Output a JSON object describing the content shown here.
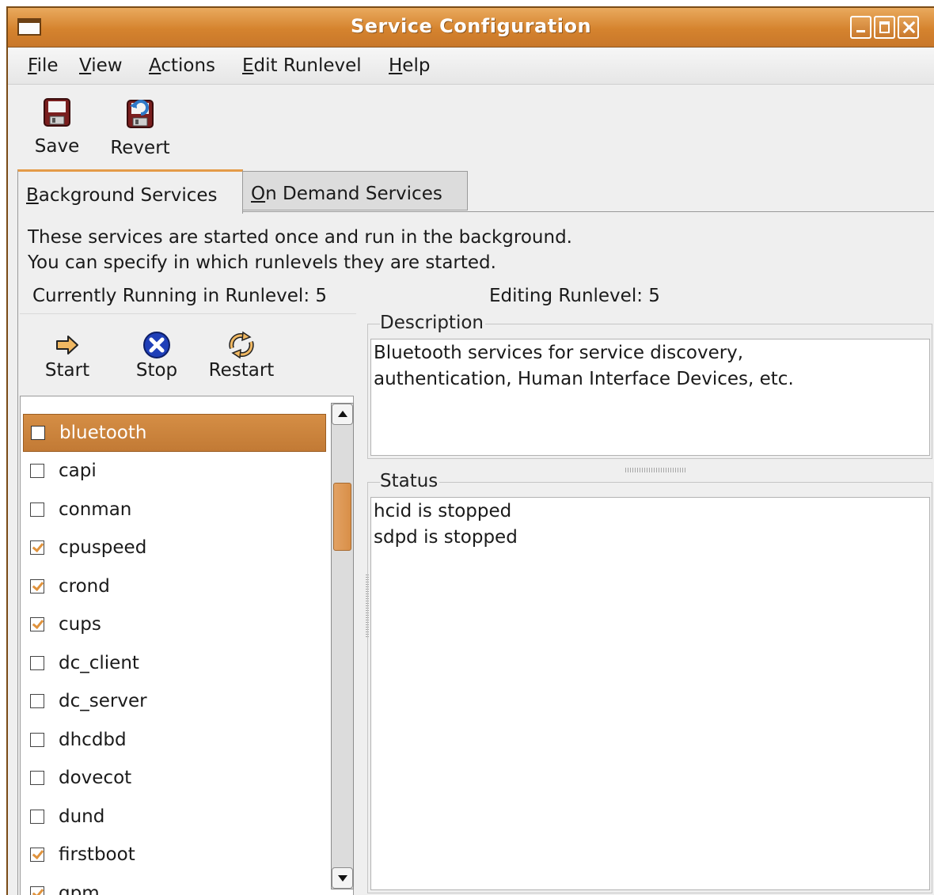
{
  "window": {
    "title": "Service Configuration"
  },
  "menubar": {
    "items": [
      {
        "mnemonic": "F",
        "rest": "ile"
      },
      {
        "mnemonic": "V",
        "rest": "iew"
      },
      {
        "mnemonic": "A",
        "rest": "ctions"
      },
      {
        "mnemonic": "E",
        "rest": "dit Runlevel"
      },
      {
        "mnemonic": "H",
        "rest": "elp"
      }
    ]
  },
  "toolbar": {
    "save_label": "Save",
    "revert_label": "Revert"
  },
  "tabs": [
    {
      "mnemonic": "B",
      "rest": "ackground Services",
      "active": true
    },
    {
      "mnemonic": "O",
      "rest": "n Demand Services",
      "active": false
    }
  ],
  "panel": {
    "intro_line1": "These services are started once and run in the background.",
    "intro_line2": "You can specify in which runlevels they are started.",
    "running_runlevel": "Currently Running in Runlevel: 5",
    "editing_runlevel": "Editing Runlevel: 5"
  },
  "actions": {
    "start_label": "Start",
    "stop_label": "Stop",
    "restart_label": "Restart"
  },
  "services": [
    {
      "name": "bluetooth",
      "enabled": false,
      "selected": true
    },
    {
      "name": "capi",
      "enabled": false
    },
    {
      "name": "conman",
      "enabled": false
    },
    {
      "name": "cpuspeed",
      "enabled": true
    },
    {
      "name": "crond",
      "enabled": true
    },
    {
      "name": "cups",
      "enabled": true
    },
    {
      "name": "dc_client",
      "enabled": false
    },
    {
      "name": "dc_server",
      "enabled": false
    },
    {
      "name": "dhcdbd",
      "enabled": false
    },
    {
      "name": "dovecot",
      "enabled": false
    },
    {
      "name": "dund",
      "enabled": false
    },
    {
      "name": "firstboot",
      "enabled": true
    },
    {
      "name": "gpm",
      "enabled": true
    }
  ],
  "description": {
    "label": "Description",
    "line1": "Bluetooth services for service discovery,",
    "line2": "authentication, Human Interface Devices, etc."
  },
  "status": {
    "label": "Status",
    "line1": "hcid is stopped",
    "line2": "sdpd is stopped"
  },
  "colors": {
    "accent": "#d5832e",
    "selection": "#c98140",
    "check": "#e0933d"
  }
}
